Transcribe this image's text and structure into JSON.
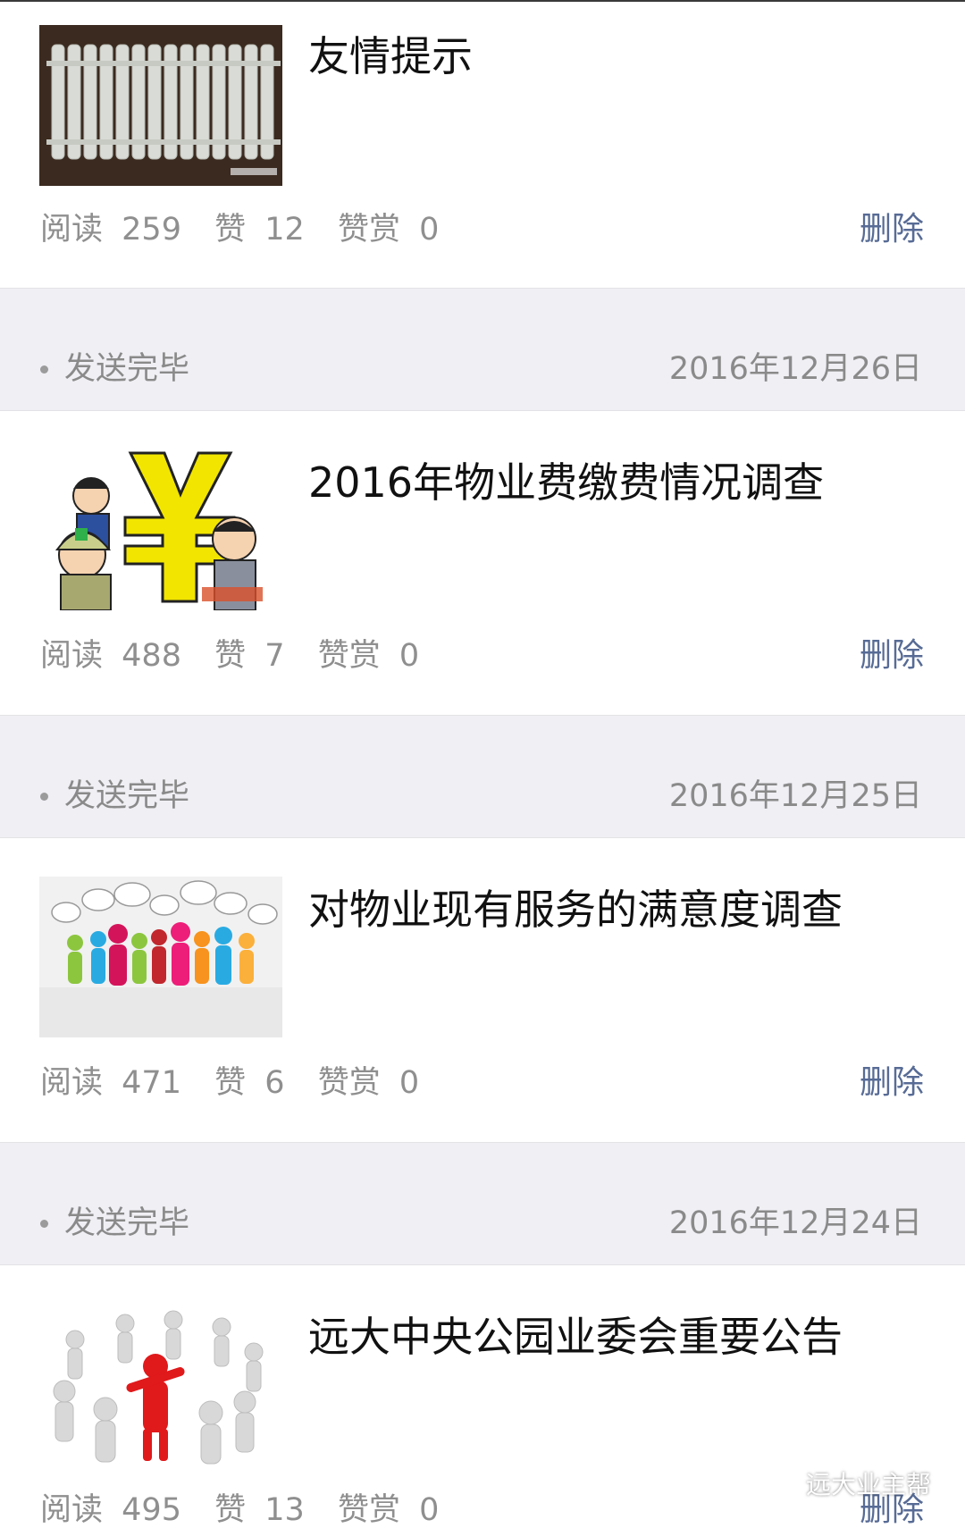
{
  "articles": [
    {
      "title": "友情提示",
      "thumb_icon": "radiator-image",
      "stats": {
        "reads_label": "阅读",
        "reads": "259",
        "likes_label": "赞",
        "likes": "12",
        "rewards_label": "赞赏",
        "rewards": "0"
      },
      "delete_label": "删除"
    },
    {
      "title": "2016年物业费缴费情况调查",
      "thumb_icon": "yuan-cartoon-image",
      "stats": {
        "reads_label": "阅读",
        "reads": "488",
        "likes_label": "赞",
        "likes": "7",
        "rewards_label": "赞赏",
        "rewards": "0"
      },
      "delete_label": "删除"
    },
    {
      "title": "对物业现有服务的满意度调查",
      "thumb_icon": "people-speech-bubbles-image",
      "stats": {
        "reads_label": "阅读",
        "reads": "471",
        "likes_label": "赞",
        "likes": "6",
        "rewards_label": "赞赏",
        "rewards": "0"
      },
      "delete_label": "删除"
    },
    {
      "title": "远大中央公园业委会重要公告",
      "thumb_icon": "circle-of-people-image",
      "stats": {
        "reads_label": "阅读",
        "reads": "495",
        "likes_label": "赞",
        "likes": "13",
        "rewards_label": "赞赏",
        "rewards": "0"
      },
      "delete_label": "删除"
    }
  ],
  "separators": [
    {
      "status": "发送完毕",
      "date": "2016年12月26日"
    },
    {
      "status": "发送完毕",
      "date": "2016年12月25日"
    },
    {
      "status": "发送完毕",
      "date": "2016年12月24日"
    }
  ],
  "watermark": {
    "text": "远大业主帮",
    "icon": "wechat-icon"
  },
  "colors": {
    "link": "#576b95",
    "meta": "#8f8f8f",
    "separator_bg": "#efeff4",
    "title": "#111111"
  }
}
